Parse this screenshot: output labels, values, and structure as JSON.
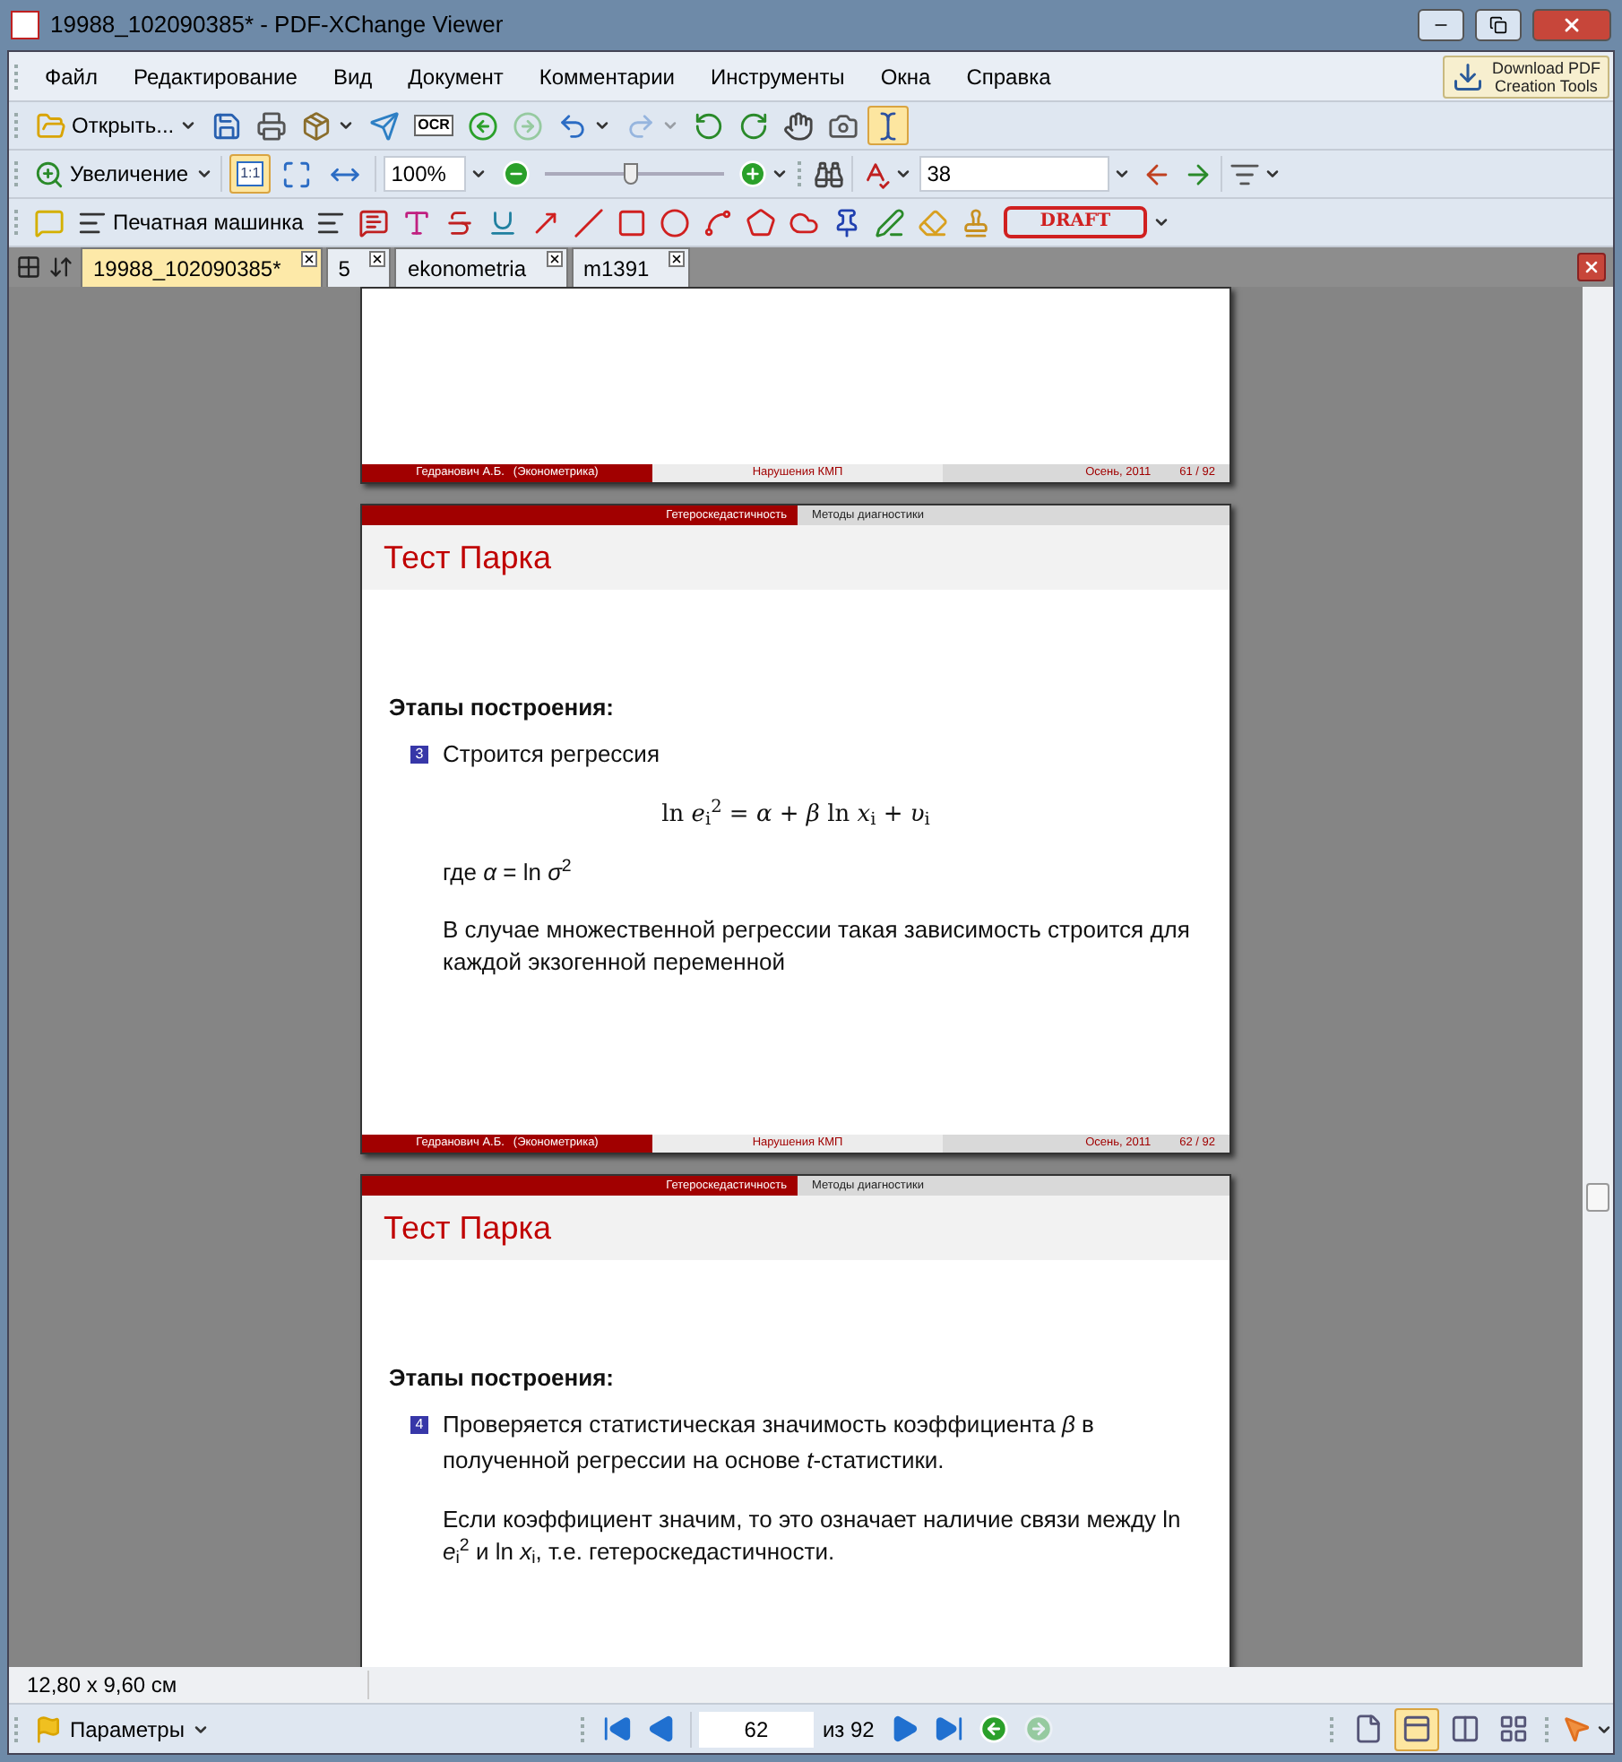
{
  "window": {
    "title": "19988_102090385* - PDF-XChange Viewer"
  },
  "menu": [
    "Файл",
    "Редактирование",
    "Вид",
    "Документ",
    "Комментарии",
    "Инструменты",
    "Окна",
    "Справка"
  ],
  "promo": {
    "line_1": "Download PDF",
    "line_2": "Creation Tools"
  },
  "toolbar_1": [
    {
      "kind": "open",
      "label": "Открыть...",
      "menu": true,
      "selected": false,
      "disabled": false
    },
    {
      "kind": "save",
      "menu": false,
      "selected": false,
      "disabled": false
    },
    {
      "kind": "print",
      "menu": false,
      "selected": false,
      "disabled": false
    },
    {
      "kind": "scan",
      "menu": true,
      "selected": false,
      "disabled": false
    },
    {
      "kind": "send",
      "menu": false,
      "selected": false,
      "disabled": false
    },
    {
      "kind": "ocr",
      "label": "OCR",
      "menu": false,
      "selected": false,
      "disabled": false
    },
    {
      "kind": "back",
      "menu": false,
      "selected": false,
      "disabled": false
    },
    {
      "kind": "forward",
      "menu": false,
      "selected": false,
      "disabled": true
    },
    {
      "kind": "undo",
      "menu": true,
      "selected": false,
      "disabled": false
    },
    {
      "kind": "redo",
      "menu": true,
      "selected": false,
      "disabled": true
    },
    {
      "kind": "rotate-left",
      "menu": false,
      "selected": false,
      "disabled": false
    },
    {
      "kind": "rotate-right",
      "menu": false,
      "selected": false,
      "disabled": false
    },
    {
      "kind": "hand",
      "menu": false,
      "selected": false,
      "disabled": false
    },
    {
      "kind": "snapshot",
      "menu": false,
      "selected": false,
      "disabled": false
    },
    {
      "kind": "select-text",
      "menu": false,
      "selected": true,
      "disabled": false
    }
  ],
  "toolbar_2": {
    "zoom_tool": {
      "label": "Увеличение"
    },
    "view_buttons": [
      {
        "kind": "actual-size",
        "label": "1:1",
        "selected": true
      },
      {
        "kind": "fit-page",
        "selected": false
      },
      {
        "kind": "fit-width",
        "selected": false
      }
    ],
    "zoom_value": "100%",
    "zoom_slider": {
      "level": 0.48
    },
    "search_value": "38"
  },
  "toolbar_3": [
    {
      "kind": "comment",
      "menu": false,
      "selected": false
    },
    {
      "kind": "typewriter",
      "label": "Печатная машинка",
      "menu": false,
      "selected": false
    },
    {
      "kind": "textbox",
      "menu": false,
      "selected": false
    },
    {
      "kind": "callout",
      "menu": false,
      "selected": false
    },
    {
      "kind": "highlight",
      "menu": false,
      "selected": false
    },
    {
      "kind": "strike",
      "menu": false,
      "selected": false
    },
    {
      "kind": "underline",
      "menu": false,
      "selected": false
    },
    {
      "kind": "arrow",
      "menu": false,
      "selected": false
    },
    {
      "kind": "line",
      "menu": false,
      "selected": false
    },
    {
      "kind": "rectangle",
      "menu": false,
      "selected": false
    },
    {
      "kind": "oval",
      "menu": false,
      "selected": false
    },
    {
      "kind": "polygon",
      "menu": false,
      "selected": false
    },
    {
      "kind": "pentagon",
      "menu": false,
      "selected": false
    },
    {
      "kind": "cloud",
      "menu": false,
      "selected": false
    },
    {
      "kind": "pin",
      "menu": false,
      "selected": false
    },
    {
      "kind": "pencil",
      "menu": false,
      "selected": false
    },
    {
      "kind": "eraser",
      "menu": false,
      "selected": false
    },
    {
      "kind": "stamp",
      "menu": false,
      "selected": false
    },
    {
      "kind": "draft",
      "label": "DRAFT",
      "menu": true,
      "selected": false
    }
  ],
  "tabs": [
    {
      "label": "19988_102090385*",
      "selected": true
    },
    {
      "label": "5",
      "selected": false
    },
    {
      "label": "ekonometria",
      "selected": false
    },
    {
      "label": "m1391",
      "selected": false
    }
  ],
  "pages": [
    {
      "footer": {
        "author": "Гедранович А.Б.",
        "course": "(Эконометрика)",
        "topic": "Нарушения КМП",
        "date": "Осень, 2011",
        "number": "61 / 92"
      }
    },
    {
      "nav": {
        "section": "Гетероскедастичность",
        "subsection": "Методы диагностики"
      },
      "title": "Тест Парка",
      "blocks": [
        {
          "kind": "heading",
          "text": "Этапы построения:"
        },
        {
          "kind": "item",
          "number": "3",
          "text": "Строится регрессия"
        },
        {
          "kind": "formula",
          "text": "ln *e*$_{i}$$^{2}$ = *α* + *β* ln *x*$_{i}$ + *υ*$_{i}$"
        },
        {
          "kind": "paragraph",
          "text": "где *α* = ln *σ*$^{2}$"
        },
        {
          "kind": "paragraph",
          "text": "В случае множественной регрессии такая зависимость строится для каждой экзогенной переменной"
        }
      ],
      "footer": {
        "author": "Гедранович А.Б.",
        "course": "(Эконометрика)",
        "topic": "Нарушения КМП",
        "date": "Осень, 2011",
        "number": "62 / 92"
      }
    },
    {
      "nav": {
        "section": "Гетероскедастичность",
        "subsection": "Методы диагностики"
      },
      "title": "Тест Парка",
      "blocks": [
        {
          "kind": "heading",
          "text": "Этапы построения:"
        },
        {
          "kind": "item",
          "number": "4",
          "text": "Проверяется статистическая значимость коэффициента *β* в полученной регрессии на основе *t*-статистики."
        },
        {
          "kind": "paragraph",
          "text": "Если коэффициент значим, то это означает наличие связи между ln *e*$_{i}$$^{2}$ и ln *x*$_{i}$, т.е. гетероскедастичности."
        }
      ]
    }
  ],
  "page_size": "12,80 x 9,60 см",
  "bottom_bar": {
    "options_label": "Параметры",
    "page_value": "62",
    "page_total": "из 92",
    "nav_buttons": [
      {
        "kind": "first",
        "disabled": false
      },
      {
        "kind": "prev",
        "disabled": false
      },
      {
        "kind": "next",
        "disabled": false
      },
      {
        "kind": "last",
        "disabled": false
      },
      {
        "kind": "back",
        "disabled": false
      },
      {
        "kind": "forward",
        "disabled": true
      }
    ],
    "layout_buttons": [
      {
        "kind": "single",
        "selected": false
      },
      {
        "kind": "continuous",
        "selected": true
      },
      {
        "kind": "facing",
        "selected": false
      },
      {
        "kind": "facing-continuous",
        "selected": false
      }
    ]
  }
}
